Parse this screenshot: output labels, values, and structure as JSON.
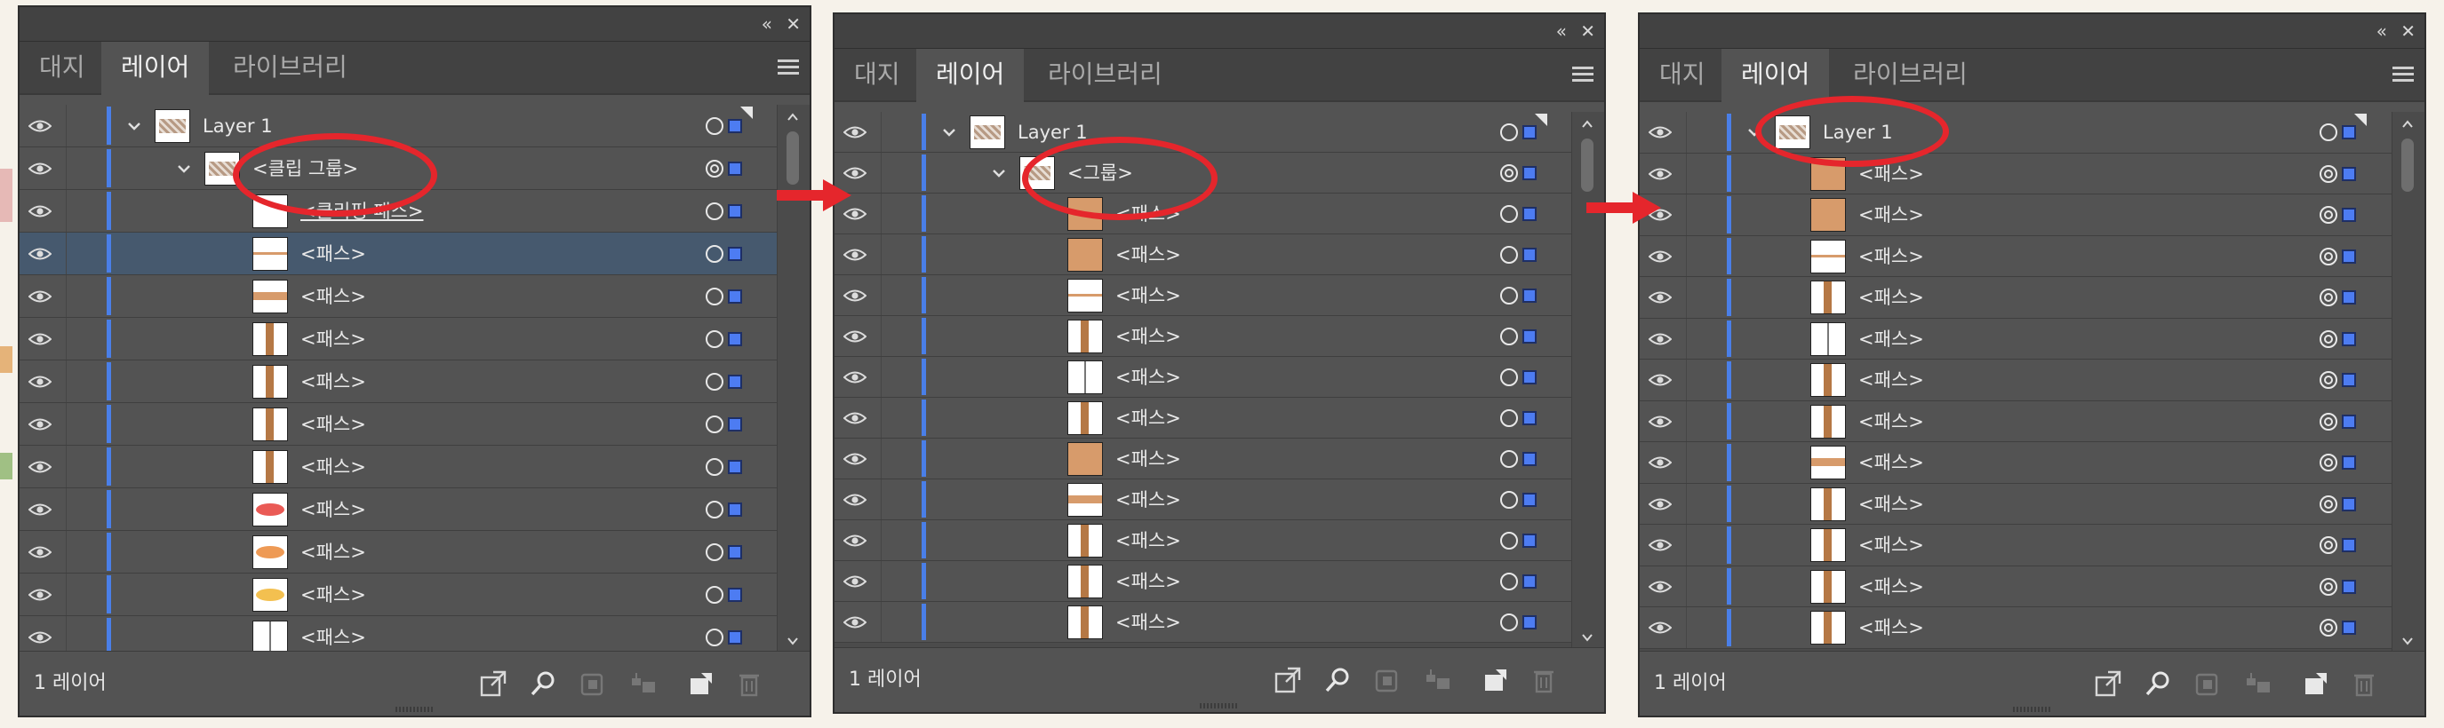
{
  "colors": {
    "panel": "#535353",
    "selected_row": "#46596e",
    "layer_color": "#4a7fe8",
    "annotation": "#e5262c",
    "path_fill": "#d79b6b"
  },
  "panels": [
    {
      "tabs": [
        "대지",
        "레이어",
        "라이브러리"
      ],
      "active_tab": 1,
      "layer_count": "1 레이어",
      "rows": [
        {
          "label": "Layer 1",
          "thumb": "art",
          "target": "o",
          "kind": "layer"
        },
        {
          "label": "<클립 그룹>",
          "thumb": "art",
          "target": "clip",
          "kind": "group"
        },
        {
          "label": "<클리핑 패스>",
          "thumb": "blank",
          "target": "o",
          "kind": "item",
          "underline": true
        },
        {
          "label": "<패스>",
          "thumb": "hline",
          "target": "o",
          "kind": "item",
          "selected": true
        },
        {
          "label": "<패스>",
          "thumb": "hband",
          "target": "o",
          "kind": "item"
        },
        {
          "label": "<패스>",
          "thumb": "vband",
          "target": "o",
          "kind": "item"
        },
        {
          "label": "<패스>",
          "thumb": "vband",
          "target": "o",
          "kind": "item"
        },
        {
          "label": "<패스>",
          "thumb": "vband",
          "target": "o",
          "kind": "item"
        },
        {
          "label": "<패스>",
          "thumb": "vband",
          "target": "o",
          "kind": "item"
        },
        {
          "label": "<패스>",
          "thumb": "ellipse-red",
          "target": "o",
          "kind": "item"
        },
        {
          "label": "<패스>",
          "thumb": "ellipse-orange",
          "target": "o",
          "kind": "item"
        },
        {
          "label": "<패스>",
          "thumb": "ellipse-yellow",
          "target": "o",
          "kind": "item"
        },
        {
          "label": "<패스>",
          "thumb": "vline",
          "target": "o",
          "kind": "item"
        }
      ]
    },
    {
      "tabs": [
        "대지",
        "레이어",
        "라이브러리"
      ],
      "active_tab": 1,
      "layer_count": "1 레이어",
      "rows": [
        {
          "label": "Layer 1",
          "thumb": "art",
          "target": "o",
          "kind": "layer"
        },
        {
          "label": "<그룹>",
          "thumb": "art",
          "target": "clip",
          "kind": "group"
        },
        {
          "label": "<패스>",
          "thumb": "fill",
          "target": "o",
          "kind": "item"
        },
        {
          "label": "<패스>",
          "thumb": "fill",
          "target": "o",
          "kind": "item"
        },
        {
          "label": "<패스>",
          "thumb": "hline",
          "target": "o",
          "kind": "item"
        },
        {
          "label": "<패스>",
          "thumb": "vband",
          "target": "o",
          "kind": "item"
        },
        {
          "label": "<패스>",
          "thumb": "vline",
          "target": "o",
          "kind": "item"
        },
        {
          "label": "<패스>",
          "thumb": "vband",
          "target": "o",
          "kind": "item"
        },
        {
          "label": "<패스>",
          "thumb": "fill",
          "target": "o",
          "kind": "item"
        },
        {
          "label": "<패스>",
          "thumb": "hband",
          "target": "o",
          "kind": "item"
        },
        {
          "label": "<패스>",
          "thumb": "vband",
          "target": "o",
          "kind": "item"
        },
        {
          "label": "<패스>",
          "thumb": "vband",
          "target": "o",
          "kind": "item"
        },
        {
          "label": "<패스>",
          "thumb": "vband",
          "target": "o",
          "kind": "item"
        }
      ]
    },
    {
      "tabs": [
        "대지",
        "레이어",
        "라이브러리"
      ],
      "active_tab": 1,
      "layer_count": "1 레이어",
      "rows": [
        {
          "label": "Layer 1",
          "thumb": "art",
          "target": "o",
          "kind": "layer"
        },
        {
          "label": "<패스>",
          "thumb": "fill",
          "target": "clip",
          "kind": "item"
        },
        {
          "label": "<패스>",
          "thumb": "fill",
          "target": "clip",
          "kind": "item"
        },
        {
          "label": "<패스>",
          "thumb": "hline",
          "target": "clip",
          "kind": "item"
        },
        {
          "label": "<패스>",
          "thumb": "vband",
          "target": "clip",
          "kind": "item"
        },
        {
          "label": "<패스>",
          "thumb": "vline",
          "target": "clip",
          "kind": "item"
        },
        {
          "label": "<패스>",
          "thumb": "vband",
          "target": "clip",
          "kind": "item"
        },
        {
          "label": "<패스>",
          "thumb": "vband",
          "target": "clip",
          "kind": "item"
        },
        {
          "label": "<패스>",
          "thumb": "hband",
          "target": "clip",
          "kind": "item"
        },
        {
          "label": "<패스>",
          "thumb": "vband",
          "target": "clip",
          "kind": "item"
        },
        {
          "label": "<패스>",
          "thumb": "vband",
          "target": "clip",
          "kind": "item"
        },
        {
          "label": "<패스>",
          "thumb": "vband",
          "target": "clip",
          "kind": "item"
        },
        {
          "label": "<패스>",
          "thumb": "vband",
          "target": "clip",
          "kind": "item"
        }
      ]
    }
  ],
  "footer_icons": [
    "locate-object-icon",
    "search-icon",
    "make-clipping-mask-icon",
    "new-sublayer-icon",
    "new-layer-icon",
    "delete-icon"
  ],
  "annotations": [
    "red-ellipse",
    "red-arrow"
  ]
}
